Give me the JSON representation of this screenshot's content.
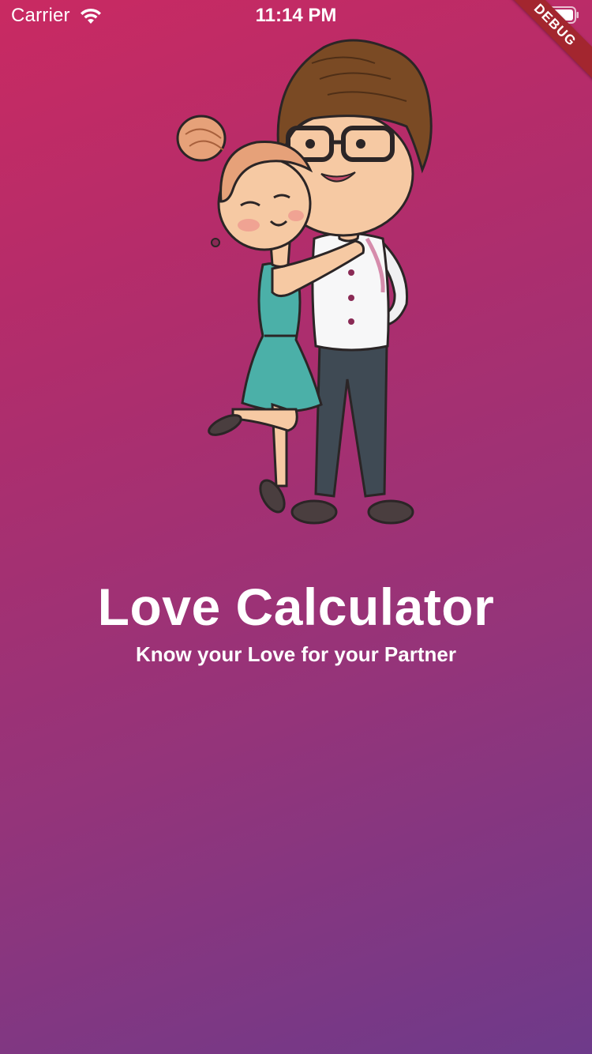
{
  "status_bar": {
    "carrier": "Carrier",
    "time": "11:14 PM"
  },
  "debug_banner": {
    "label": "DEBUG"
  },
  "hero": {
    "title": "Love Calculator",
    "subtitle": "Know your Love for your Partner"
  },
  "colors": {
    "gradient_top": "#c92a62",
    "gradient_bottom": "#6e3a8a",
    "text": "#ffffff",
    "debug_ribbon": "#a3262f"
  },
  "icons": [
    "wifi-icon",
    "battery-icon",
    "couple-illustration"
  ]
}
